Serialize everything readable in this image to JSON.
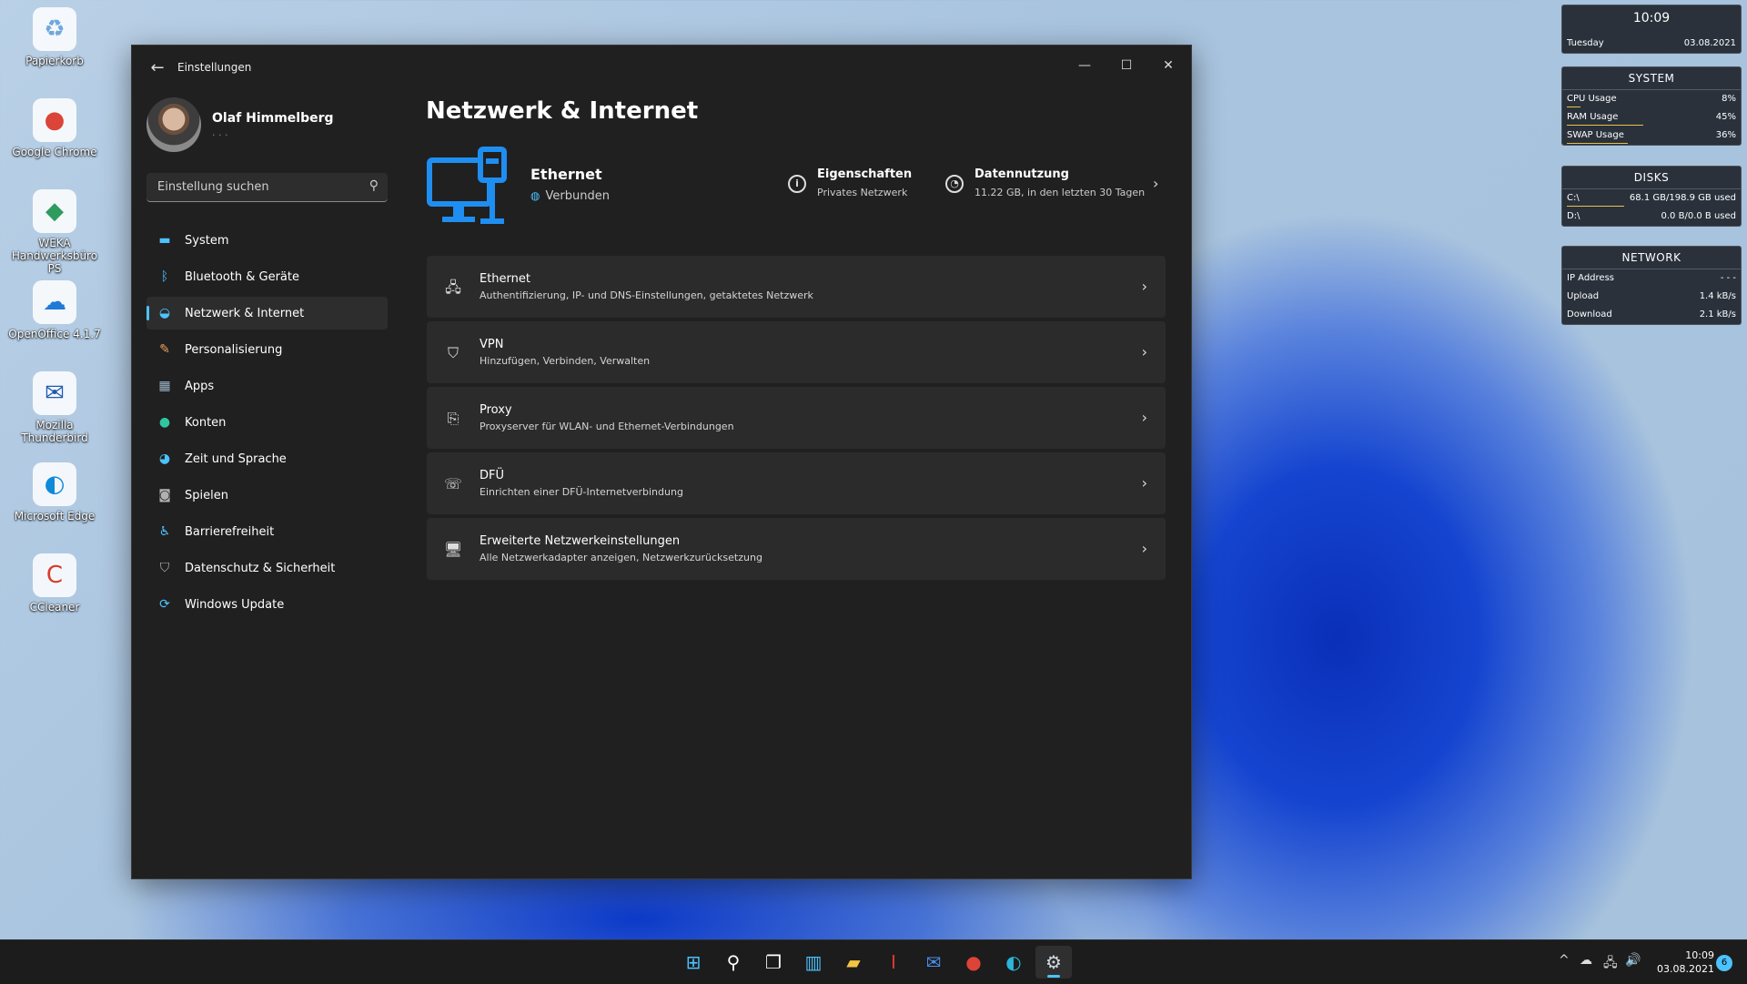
{
  "desktop": {
    "icons": [
      {
        "label": "Papierkorb",
        "glyph": "♻",
        "color": "#6fa8dc"
      },
      {
        "label": "Google Chrome",
        "glyph": "●",
        "color": "#db4437"
      },
      {
        "label": "WEKA Handwerksbüro PS",
        "glyph": "◆",
        "color": "#2e9b5f"
      },
      {
        "label": "OpenOffice 4.1.7",
        "glyph": "☁",
        "color": "#1f7ad6"
      },
      {
        "label": "Mozilla Thunderbird",
        "glyph": "✉",
        "color": "#1f5ab3"
      },
      {
        "label": "Microsoft Edge",
        "glyph": "◐",
        "color": "#0e8ad8"
      },
      {
        "label": "CCleaner",
        "glyph": "C",
        "color": "#d83b2d"
      }
    ]
  },
  "window": {
    "title": "Einstellungen",
    "controls": {
      "minimize": "—",
      "maximize": "☐",
      "close": "✕"
    },
    "back": "←"
  },
  "profile": {
    "name": "Olaf Himmelberg",
    "sub": "·  ·  ·"
  },
  "search": {
    "placeholder": "Einstellung suchen"
  },
  "nav": [
    {
      "label": "System",
      "icon": "system-icon",
      "glyph": "▬",
      "color": "#4cc2ff"
    },
    {
      "label": "Bluetooth & Geräte",
      "icon": "bluetooth-icon",
      "glyph": "ᛒ",
      "color": "#4cc2ff"
    },
    {
      "label": "Netzwerk & Internet",
      "icon": "wifi-icon",
      "glyph": "◒",
      "color": "#4cc2ff",
      "active": true
    },
    {
      "label": "Personalisierung",
      "icon": "brush-icon",
      "glyph": "✎",
      "color": "#e8a060"
    },
    {
      "label": "Apps",
      "icon": "apps-icon",
      "glyph": "▦",
      "color": "#9db4c8"
    },
    {
      "label": "Konten",
      "icon": "account-icon",
      "glyph": "●",
      "color": "#2fc7a0"
    },
    {
      "label": "Zeit und Sprache",
      "icon": "globe-clock-icon",
      "glyph": "◕",
      "color": "#4cc2ff"
    },
    {
      "label": "Spielen",
      "icon": "gamepad-icon",
      "glyph": "◙",
      "color": "#b0b0b0"
    },
    {
      "label": "Barrierefreiheit",
      "icon": "accessibility-icon",
      "glyph": "♿",
      "color": "#4cc2ff"
    },
    {
      "label": "Datenschutz & Sicherheit",
      "icon": "shield-icon",
      "glyph": "⛉",
      "color": "#b0b0b0"
    },
    {
      "label": "Windows Update",
      "icon": "update-icon",
      "glyph": "⟳",
      "color": "#4cc2ff"
    }
  ],
  "page": {
    "title": "Netzwerk & Internet"
  },
  "hero": {
    "name": "Ethernet",
    "status": "Verbunden",
    "properties": {
      "title": "Eigenschaften",
      "sub": "Privates Netzwerk"
    },
    "usage": {
      "title": "Datennutzung",
      "sub": "11.22 GB, in den letzten 30 Tagen"
    }
  },
  "cards": [
    {
      "title": "Ethernet",
      "sub": "Authentifizierung, IP- und DNS-Einstellungen, getaktetes Netzwerk",
      "icon": "ethernet-icon",
      "glyph": "🖧"
    },
    {
      "title": "VPN",
      "sub": "Hinzufügen, Verbinden, Verwalten",
      "icon": "vpn-shield-icon",
      "glyph": "⛉"
    },
    {
      "title": "Proxy",
      "sub": "Proxyserver für WLAN- und Ethernet-Verbindungen",
      "icon": "proxy-icon",
      "glyph": "⎘"
    },
    {
      "title": "DFÜ",
      "sub": "Einrichten einer DFÜ-Internetverbindung",
      "icon": "dialup-icon",
      "glyph": "☏"
    },
    {
      "title": "Erweiterte Netzwerkeinstellungen",
      "sub": "Alle Netzwerkadapter anzeigen, Netzwerkzurücksetzung",
      "icon": "advanced-network-icon",
      "glyph": "🖥"
    }
  ],
  "gadgets": {
    "clock": {
      "time": "10:09",
      "day": "Tuesday",
      "date": "03.08.2021"
    },
    "system": {
      "title": "SYSTEM",
      "rows": [
        {
          "label": "CPU Usage",
          "value": "8%",
          "level": 0.08
        },
        {
          "label": "RAM Usage",
          "value": "45%",
          "level": 0.45
        },
        {
          "label": "SWAP Usage",
          "value": "36%",
          "level": 0.36
        }
      ]
    },
    "disks": {
      "title": "DISKS",
      "rows": [
        {
          "label": "C:\\",
          "value": "68.1 GB/198.9 GB used",
          "level": 0.34
        },
        {
          "label": "D:\\",
          "value": "0.0 B/0.0 B used",
          "level": 0
        }
      ]
    },
    "network": {
      "title": "NETWORK",
      "rows": [
        {
          "label": "IP Address",
          "value": "- - -"
        },
        {
          "label": "Upload",
          "value": "1.4 kB/s"
        },
        {
          "label": "Download",
          "value": "2.1 kB/s"
        }
      ]
    }
  },
  "taskbar": {
    "apps": [
      {
        "name": "start-button",
        "glyph": "⊞",
        "color": "#4cc2ff"
      },
      {
        "name": "search-button",
        "glyph": "⚲",
        "color": "#ffffff"
      },
      {
        "name": "task-view-button",
        "glyph": "❐",
        "color": "#ffffff"
      },
      {
        "name": "widgets-button",
        "glyph": "▥",
        "color": "#4cc2ff"
      },
      {
        "name": "file-explorer-button",
        "glyph": "▰",
        "color": "#f4c542"
      },
      {
        "name": "weka-button",
        "glyph": "I",
        "color": "#d83b2d"
      },
      {
        "name": "thunderbird-button",
        "glyph": "✉",
        "color": "#4a8ee8"
      },
      {
        "name": "chrome-button",
        "glyph": "●",
        "color": "#db4437"
      },
      {
        "name": "edge-button",
        "glyph": "◐",
        "color": "#2bb5d8"
      },
      {
        "name": "settings-button",
        "glyph": "⚙",
        "color": "#cfd8e0",
        "active": true
      }
    ],
    "tray": {
      "chevron": "^",
      "cloud": "☁",
      "network": "🖧",
      "volume": "🔊"
    },
    "time": "10:09",
    "date": "03.08.2021",
    "notifications": "6"
  }
}
